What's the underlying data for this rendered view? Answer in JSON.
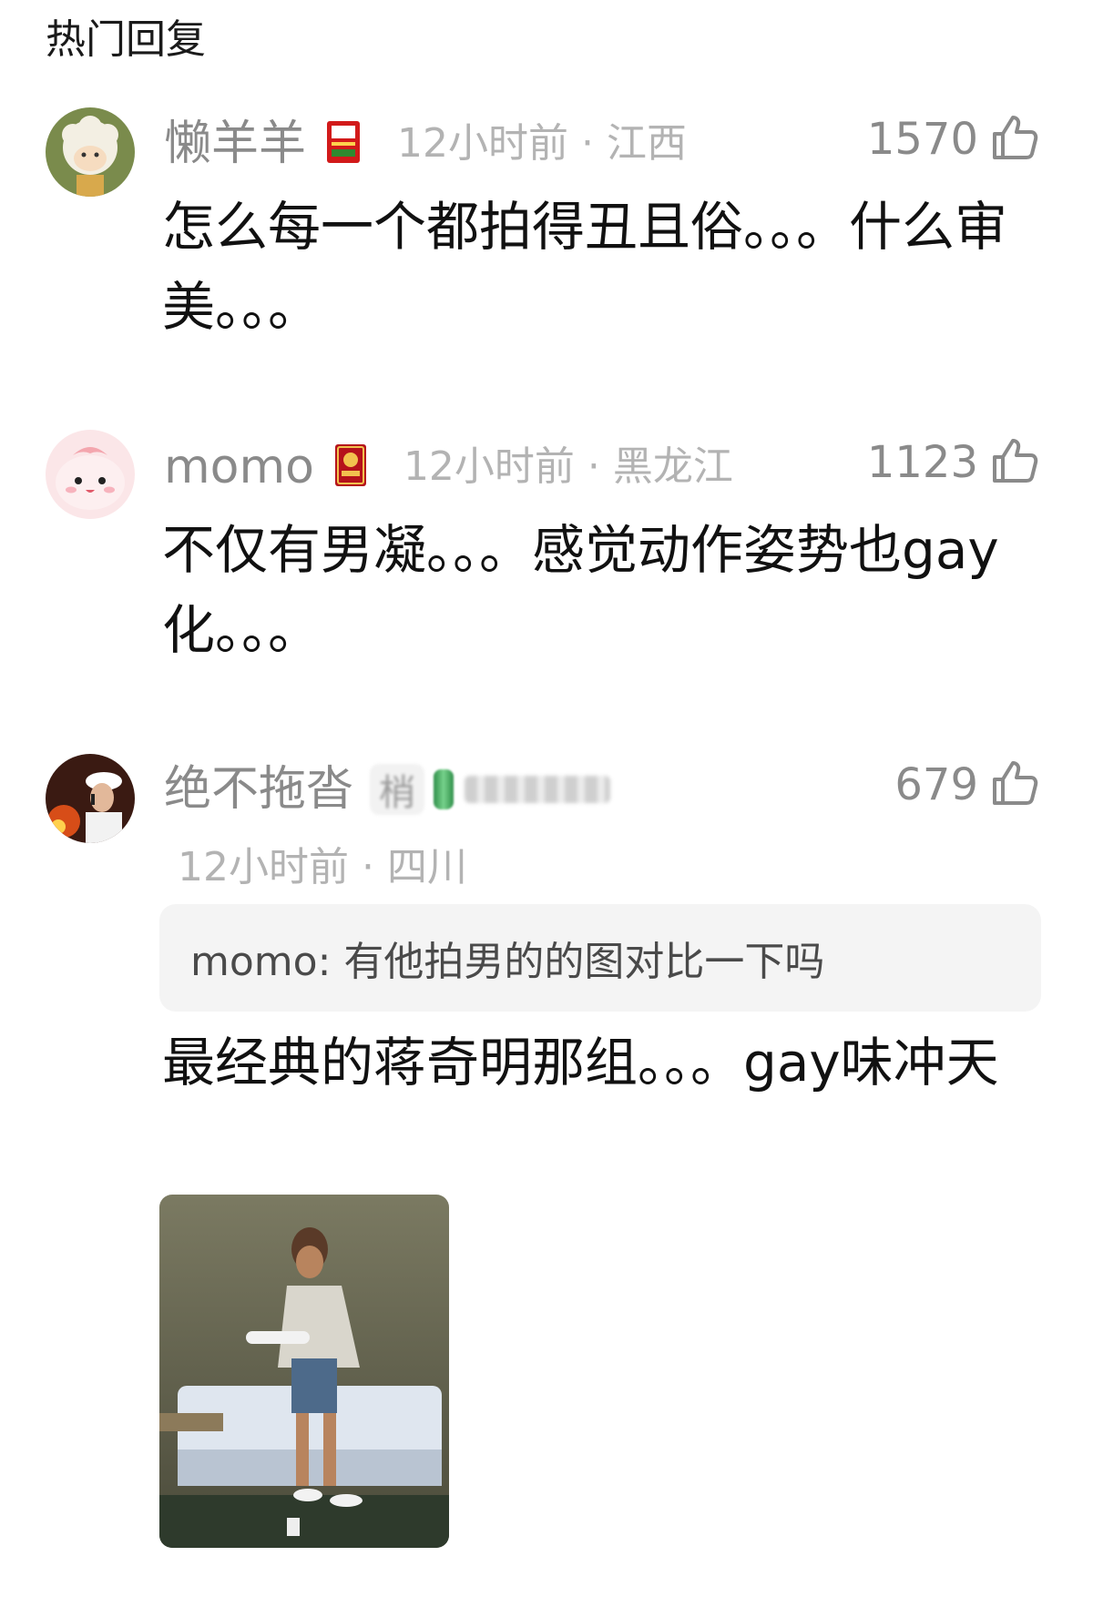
{
  "section_title": "热门回复",
  "comments": [
    {
      "username": "懒羊羊",
      "time_location": "12小时前 · 江西",
      "likes": "1570",
      "text": "怎么每一个都拍得丑且俗。。。什么审美。。。",
      "badge_icon": "red-card-badge-icon"
    },
    {
      "username": "momo",
      "time_location": "12小时前 · 黑龙江",
      "likes": "1123",
      "text": "不仅有男凝。。。感觉动作姿势也gay化。。。",
      "badge_icon": "red-medal-badge-icon"
    },
    {
      "username": "绝不拖沓",
      "blurred_tag": "梢",
      "time_location": "12小时前 · 四川",
      "likes": "679",
      "quote": "momo: 有他拍男的的图对比一下吗",
      "text": "最经典的蒋奇明那组。。。gay味冲天",
      "image_icon": "photo-thumbnail-icon"
    }
  ],
  "colors": {
    "meta_gray": "#8a8a8a",
    "light_gray": "#b3b3b3",
    "quote_bg": "#f4f4f4",
    "badge_red": "#c8102e"
  }
}
